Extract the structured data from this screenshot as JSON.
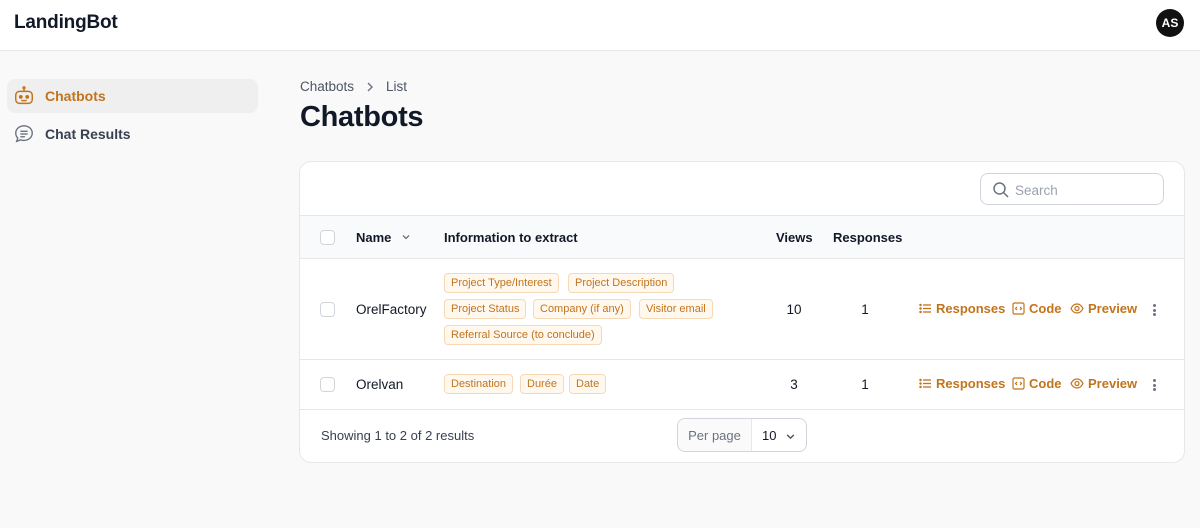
{
  "app": {
    "brand": "LandingBot",
    "avatar_initials": "AS",
    "accent": "#c2741d"
  },
  "sidebar": {
    "items": [
      {
        "label": "Chatbots",
        "icon": "robot-icon",
        "active": true
      },
      {
        "label": "Chat Results",
        "icon": "chat-bubble-icon",
        "active": false
      }
    ]
  },
  "breadcrumb": {
    "parent": "Chatbots",
    "current": "List"
  },
  "page": {
    "title": "Chatbots"
  },
  "search": {
    "placeholder": "Search",
    "value": ""
  },
  "table": {
    "columns": {
      "name": "Name",
      "info": "Information to extract",
      "views": "Views",
      "responses": "Responses"
    },
    "rows": [
      {
        "name": "OrelFactory",
        "tags": [
          "Project Type/Interest",
          "Project Description",
          "Project Status",
          "Company (if any)",
          "Visitor email",
          "Referral Source (to conclude)"
        ],
        "views": "10",
        "responses": "1"
      },
      {
        "name": "Orelvan",
        "tags": [
          "Destination",
          "Durée",
          "Date"
        ],
        "views": "3",
        "responses": "1"
      }
    ],
    "actions": {
      "responses": "Responses",
      "code": "Code",
      "preview": "Preview"
    }
  },
  "footer": {
    "summary": "Showing 1 to 2 of 2 results",
    "per_page_label": "Per page",
    "per_page_value": "10"
  }
}
